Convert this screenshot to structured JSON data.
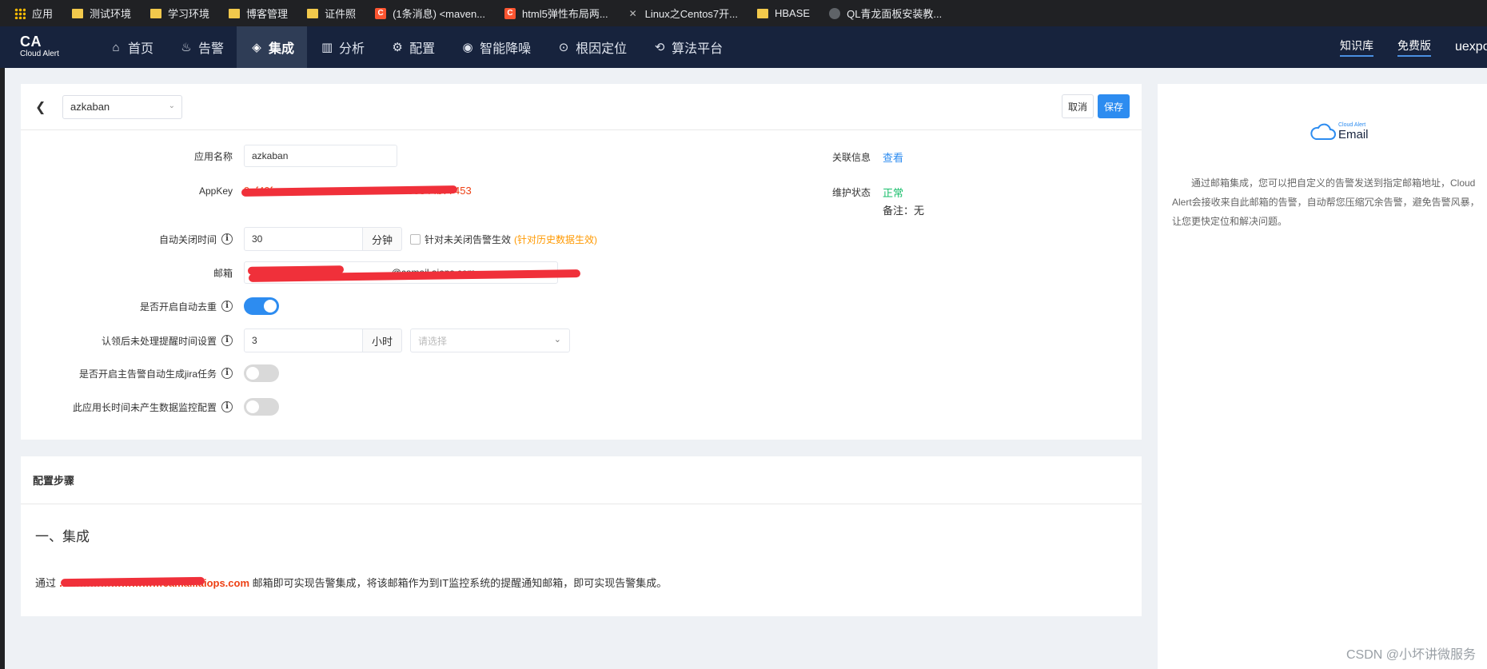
{
  "bookmarks": [
    {
      "label": "应用",
      "icon": "apps-icon"
    },
    {
      "label": "测试环境",
      "icon": "folder-icon"
    },
    {
      "label": "学习环境",
      "icon": "folder-icon"
    },
    {
      "label": "博客管理",
      "icon": "folder-icon"
    },
    {
      "label": "证件照",
      "icon": "folder-icon"
    },
    {
      "label": "(1条消息) <maven...",
      "icon": "csdn-icon"
    },
    {
      "label": "html5弹性布局两...",
      "icon": "csdn-icon"
    },
    {
      "label": "Linux之Centos7开...",
      "icon": "linux-icon"
    },
    {
      "label": "HBASE",
      "icon": "folder-icon"
    },
    {
      "label": "QL青龙面板安装教...",
      "icon": "globe-icon"
    }
  ],
  "header": {
    "logo_title": "CA",
    "logo_sub": "Cloud Alert",
    "nav": [
      {
        "label": "首页",
        "icon": "home-icon",
        "active": false
      },
      {
        "label": "告警",
        "icon": "alarm-icon",
        "active": false
      },
      {
        "label": "集成",
        "icon": "layers-icon",
        "active": true
      },
      {
        "label": "分析",
        "icon": "bar-chart-icon",
        "active": false
      },
      {
        "label": "配置",
        "icon": "gear-icon",
        "active": false
      },
      {
        "label": "智能降噪",
        "icon": "noise-icon",
        "active": false
      },
      {
        "label": "根因定位",
        "icon": "target-icon",
        "active": false
      },
      {
        "label": "算法平台",
        "icon": "algorithm-icon",
        "active": false
      }
    ],
    "links": [
      "知识库",
      "免费版"
    ],
    "user": "uexpo"
  },
  "form": {
    "app_select": "azkaban",
    "cancel": "取消",
    "save": "保存",
    "app_name_label": "应用名称",
    "app_name_value": "azkaban",
    "appkey_label": "AppKey",
    "appkey_value": "9ef40f…………………………………58344b77453",
    "related_label": "关联信息",
    "related_link": "查看",
    "maint_label": "维护状态",
    "maint_status": "正常",
    "maint_note": "备注：无",
    "auto_close_label": "自动关闭时间",
    "auto_close_value": "30",
    "auto_close_unit": "分钟",
    "auto_close_check": "针对未关闭告警生效",
    "auto_close_hint": "(针对历史数据生效)",
    "email_label": "邮箱",
    "email_value": "7……………………………………@camail.aiops.com",
    "dedup_label": "是否开启自动去重",
    "dedup_on": true,
    "remind_label": "认领后未处理提醒时间设置",
    "remind_value": "3",
    "remind_unit": "小时",
    "remind_placeholder": "请选择",
    "jira_label": "是否开启主告警自动生成jira任务",
    "jira_on": false,
    "nodata_label": "此应用长时间未产生数据监控配置",
    "nodata_on": false
  },
  "steps": {
    "title": "配置步骤",
    "heading": "一、集成",
    "prefix": "通过",
    "email": "…………………………camail.aiops.com",
    "suffix": "邮箱即可实现告警集成，将该邮箱作为到IT监控系统的提醒通知邮箱，即可实现告警集成。"
  },
  "side": {
    "logo_small": "Cloud Alert",
    "logo_big": "Email",
    "text": "通过邮箱集成，您可以把自定义的告警发送到指定邮箱地址，Cloud Alert会接收来自此邮箱的告警，自动帮您压缩冗余告警，避免告警风暴，让您更快定位和解决问题。"
  },
  "watermark": "CSDN @小坏讲微服务",
  "colors": {
    "accent": "#2d8cf0",
    "header": "#17233d",
    "ok": "#19be6b",
    "warn": "#ff9900",
    "redact": "#f0303a"
  }
}
